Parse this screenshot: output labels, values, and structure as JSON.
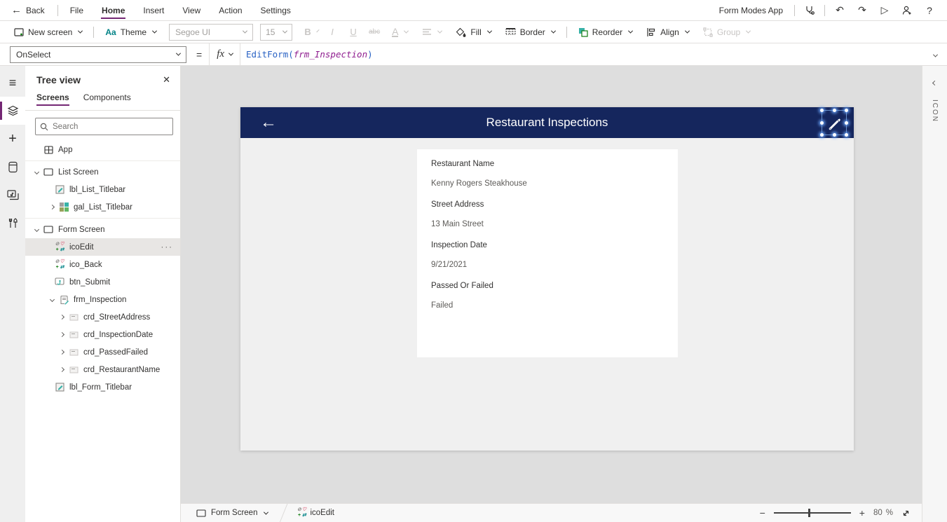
{
  "colors": {
    "accent_purple": "#742774",
    "titlebar_navy": "#15265d",
    "formula_function_blue": "#2962c4",
    "formula_identifier_purple": "#8f1d8f",
    "canvas_gray": "#dedede"
  },
  "icons": {
    "back_arrow": "←",
    "undo": "↶",
    "redo": "↷",
    "play": "▷",
    "help": "?",
    "hamburger": "≡",
    "insert_plus": "+",
    "theme_glyph": "Aa",
    "close_x": "✕",
    "ico_no": "⊘",
    "ico_heart": "♡",
    "ico_plus": "+",
    "ico_arrows": "⇄"
  },
  "header": {
    "back": "Back",
    "menus": [
      "File",
      "Home",
      "Insert",
      "View",
      "Action",
      "Settings"
    ],
    "app_name": "Form Modes App"
  },
  "toolbar": {
    "new_screen": "New screen",
    "theme": "Theme",
    "font_name": "Segoe UI",
    "font_size": "15",
    "bold": "B",
    "italic": "I",
    "underline": "U",
    "strikethrough": "abc",
    "font_color": "A",
    "fill": "Fill",
    "border": "Border",
    "reorder": "Reorder",
    "align": "Align",
    "group": "Group"
  },
  "formula_bar": {
    "property": "OnSelect",
    "equals": "=",
    "fx": "fx",
    "code_fn": "EditForm(",
    "code_arg": "frm_Inspection",
    "code_close": ")"
  },
  "tree_view": {
    "title": "Tree view",
    "tab_screens": "Screens",
    "tab_components": "Components",
    "search_placeholder": "Search",
    "more": "···",
    "items": [
      {
        "label": "App"
      },
      {
        "label": "List Screen"
      },
      {
        "label": "lbl_List_Titlebar"
      },
      {
        "label": "gal_List_Titlebar"
      },
      {
        "label": "Form Screen"
      },
      {
        "label": "icoEdit"
      },
      {
        "label": "ico_Back"
      },
      {
        "label": "btn_Submit"
      },
      {
        "label": "frm_Inspection"
      },
      {
        "label": "crd_StreetAddress"
      },
      {
        "label": "crd_InspectionDate"
      },
      {
        "label": "crd_PassedFailed"
      },
      {
        "label": "crd_RestaurantName"
      },
      {
        "label": "lbl_Form_Titlebar"
      }
    ]
  },
  "canvas": {
    "screen_title": "Restaurant Inspections",
    "form_fields": [
      {
        "label": "Restaurant Name",
        "value": "Kenny Rogers Steakhouse"
      },
      {
        "label": "Street Address",
        "value": "13 Main Street"
      },
      {
        "label": "Inspection Date",
        "value": "9/21/2021"
      },
      {
        "label": "Passed Or Failed",
        "value": "Failed"
      }
    ]
  },
  "status_bar": {
    "screen_name": "Form Screen",
    "control_name": "icoEdit",
    "zoom_percent": "80",
    "percent_sign": "%"
  },
  "right_panel": {
    "collapsed_label": "ICON"
  }
}
